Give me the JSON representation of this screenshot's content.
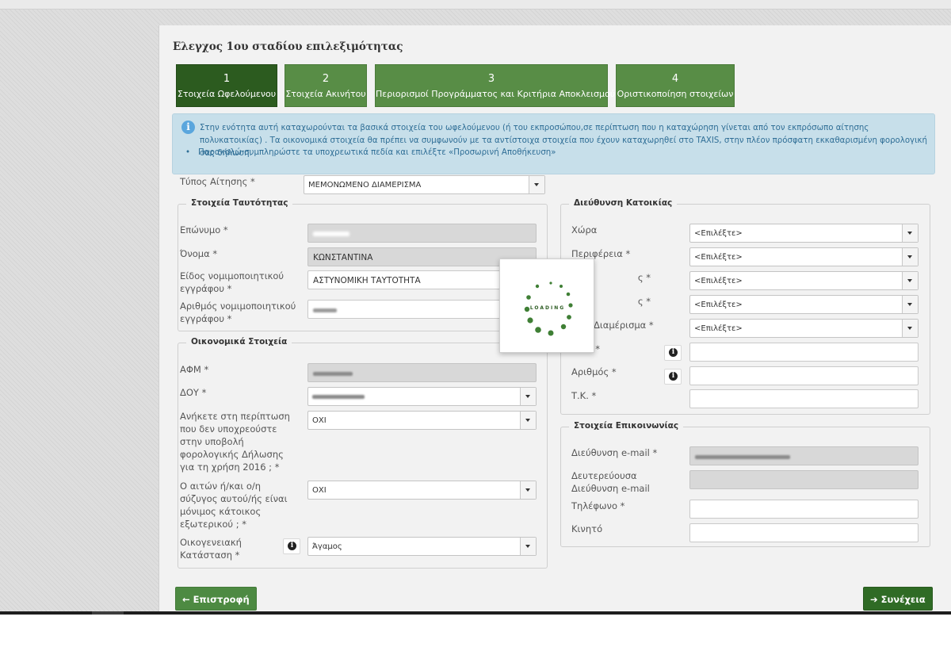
{
  "page_title": "Ελεγχος 1ου σταδίου επιλεξιμότητας",
  "steps": [
    {
      "num": "1",
      "label": "Στοιχεία Ωφελούμενου",
      "active": true
    },
    {
      "num": "2",
      "label": "Στοιχεία Ακινήτου",
      "active": false
    },
    {
      "num": "3",
      "label": "Περιορισμοί Προγράμματος και Κριτήρια Αποκλεισμού",
      "active": false
    },
    {
      "num": "4",
      "label": "Οριστικοποίηση στοιχείων",
      "active": false
    }
  ],
  "info": {
    "text": "Στην ενότητα αυτή καταχωρούνται τα βασικά στοιχεία του ωφελούμενου (ή του εκπροσώπου,σε περίπτωση που η καταχώρηση γίνεται από τον εκπρόσωπο αίτησης πολυκατοικίας) . Τα οικονομικά στοιχεία θα πρέπει να συμφωνούν με τα αντίστοιχα στοιχεία που έχουν καταχωρηθεί στο TAXIS, στην πλέον πρόσφατη εκκαθαρισμένη φορολογική σας δήλωση.",
    "bullet": "Παρακαλώ συμπληρώστε τα υποχρεωτικά πεδία και επιλέξτε «Προσωρινή Αποθήκευση»"
  },
  "application_type": {
    "label": "Τύπος Αίτησης *",
    "value": "ΜΕΜΟΝΩΜΕΝΟ ΔΙΑΜΕΡΙΣΜΑ"
  },
  "identity": {
    "legend": "Στοιχεία Ταυτότητας",
    "surname_label": "Επώνυμο *",
    "name_label": "Όνομα *",
    "name_value": "ΚΩΝΣΤΑΝΤΙΝΑ",
    "doc_type_label": "Είδος νομιμοποιητικού εγγράφου *",
    "doc_type_value": "ΑΣΤΥΝΟΜΙΚΗ ΤΑΥΤΟΤΗΤΑ",
    "doc_number_label": "Αριθμός νομιμοποιητικού εγγράφου *"
  },
  "financial": {
    "legend": "Οικονομικά Στοιχεία",
    "afm_label": "ΑΦΜ *",
    "doy_label": "ΔΟΥ *",
    "not_obliged_label": "Ανήκετε στη περίπτωση που δεν υποχρεούστε στην υποβολή φορολογικής Δήλωσης για τη χρήση 2016 ; *",
    "not_obliged_value": "ΟΧΙ",
    "resident_abroad_label": "Ο αιτών ή/και ο/η σύζυγος αυτού/ής είναι μόνιμος κάτοικος εξωτερικού ; *",
    "resident_abroad_value": "ΟΧΙ",
    "marital_label": "Οικογενειακή Κατάσταση *",
    "marital_value": "Άγαμος"
  },
  "address": {
    "legend": "Διεύθυνση Κατοικίας",
    "country_label": "Χώρα",
    "region_label": "Περιφέρεια *",
    "label3": "ς *",
    "label4": "ς *",
    "label5": "Διαμέρισμα *",
    "label6": "*",
    "number_label": "Αριθμός *",
    "tk_label": "Τ.Κ. *",
    "select_placeholder": "<Επιλέξτε>"
  },
  "contact": {
    "legend": "Στοιχεία Επικοινωνίας",
    "email_label": "Διεύθυνση e-mail *",
    "email2_label": "Δευτερεύουσα Διεύθυνση e-mail",
    "phone_label": "Τηλέφωνο *",
    "mobile_label": "Κινητό"
  },
  "buttons": {
    "back": "← Επιστροφή",
    "next": "➔ Συνέχεια"
  },
  "loading_text": "LOADING",
  "colors": {
    "step_active": "#2c5b1f",
    "step": "#588d46",
    "info_bg": "#c7dfea",
    "info_text": "#2f6e96"
  }
}
